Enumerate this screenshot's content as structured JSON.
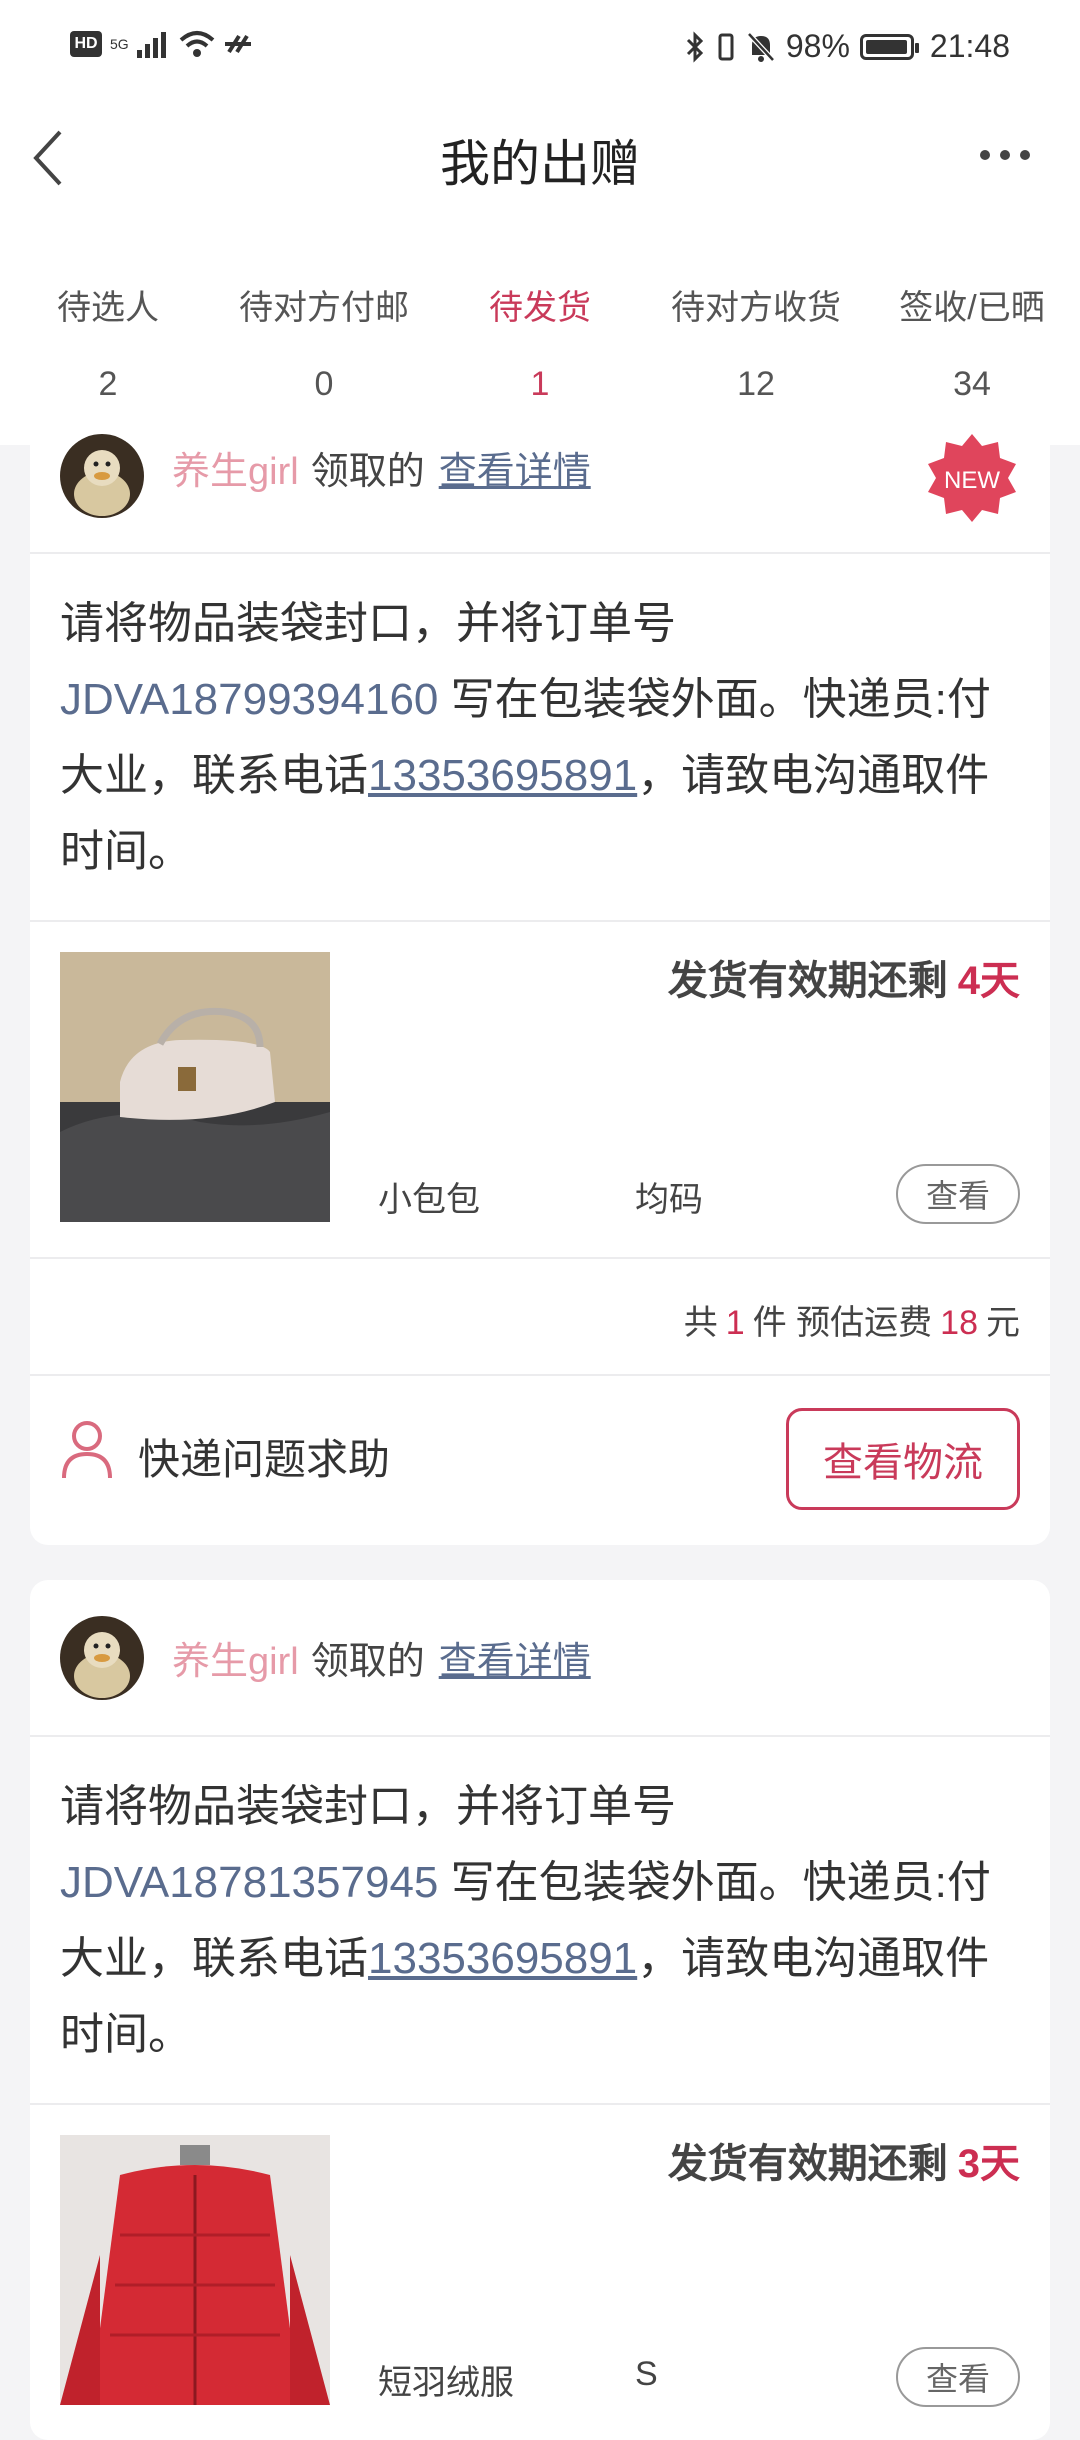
{
  "status_bar": {
    "hd": "HD",
    "network": "5G",
    "battery": "98%",
    "time": "21:48"
  },
  "header": {
    "title": "我的出赠"
  },
  "tabs": [
    {
      "label": "待选人",
      "count": "2"
    },
    {
      "label": "待对方付邮",
      "count": "0"
    },
    {
      "label": "待发货",
      "count": "1",
      "active": true
    },
    {
      "label": "待对方收货",
      "count": "12"
    },
    {
      "label": "签收/已晒",
      "count": "34"
    }
  ],
  "orders": [
    {
      "nickname": "养生girl",
      "claimed": "领取的",
      "detail_link": "查看详情",
      "badge": "NEW",
      "msg_pre": "请将物品装袋封口，并将订单号 ",
      "order_no": "JDVA18799394160",
      "msg_mid": " 写在包装袋外面。快递员:付大业，联系电话",
      "phone": "13353695891",
      "msg_post": "，请致电沟通取件时间。",
      "deadline_label": "发货有效期还剩",
      "deadline_days": "4天",
      "product_name": "小包包",
      "product_size": "均码",
      "view_label": "查看",
      "summary_total": "共",
      "summary_count": "1",
      "summary_unit": "件 预估运费",
      "summary_fee": "18",
      "summary_currency": "元",
      "help_label": "快递问题求助",
      "logistics_label": "查看物流"
    },
    {
      "nickname": "养生girl",
      "claimed": "领取的",
      "detail_link": "查看详情",
      "msg_pre": "请将物品装袋封口，并将订单号 ",
      "order_no": "JDVA18781357945",
      "msg_mid": " 写在包装袋外面。快递员:付大业，联系电话",
      "phone": "13353695891",
      "msg_post": "，请致电沟通取件时间。",
      "deadline_label": "发货有效期还剩",
      "deadline_days": "3天",
      "product_name": "短羽绒服",
      "product_size": "S",
      "view_label": "查看"
    }
  ],
  "colors": {
    "accent": "#d3305a",
    "link": "#5a6c8e",
    "nickname": "#e69aa8"
  }
}
